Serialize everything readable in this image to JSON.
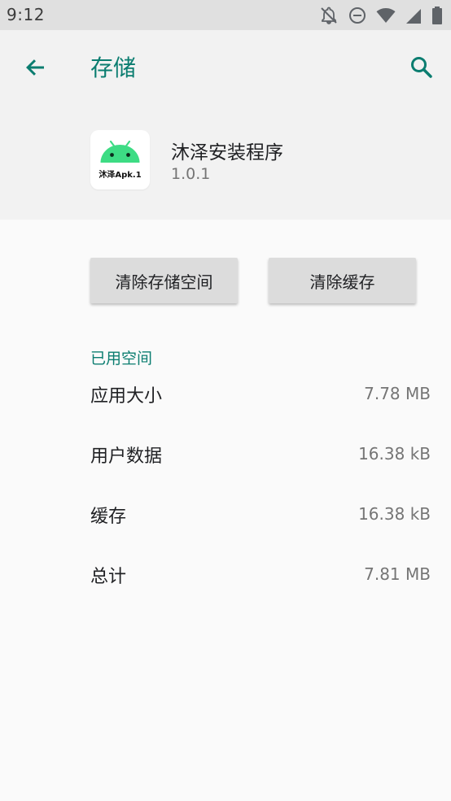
{
  "status_bar": {
    "time": "9:12",
    "icons": [
      "notifications-off-icon",
      "do-not-disturb-icon",
      "wifi-icon",
      "signal-icon",
      "battery-icon"
    ]
  },
  "header": {
    "title": "存储",
    "back_icon": "arrow-back-icon",
    "search_icon": "search-icon"
  },
  "app": {
    "icon_caption": "沐泽Apk.1",
    "name": "沐泽安装程序",
    "version": "1.0.1"
  },
  "actions": {
    "clear_storage": "清除存储空间",
    "clear_cache": "清除缓存"
  },
  "storage": {
    "section_label": "已用空间",
    "rows": [
      {
        "label": "应用大小",
        "value": "7.78 MB"
      },
      {
        "label": "用户数据",
        "value": "16.38 kB"
      },
      {
        "label": "缓存",
        "value": "16.38 kB"
      },
      {
        "label": "总计",
        "value": "7.81 MB"
      }
    ]
  },
  "colors": {
    "accent": "#0b7d70",
    "android_green": "#3ddc84",
    "status_bar_bg": "#e0e0e0",
    "header_bg": "#f2f2f2",
    "page_bg": "#fafafa",
    "button_bg": "#dcdcdc"
  }
}
